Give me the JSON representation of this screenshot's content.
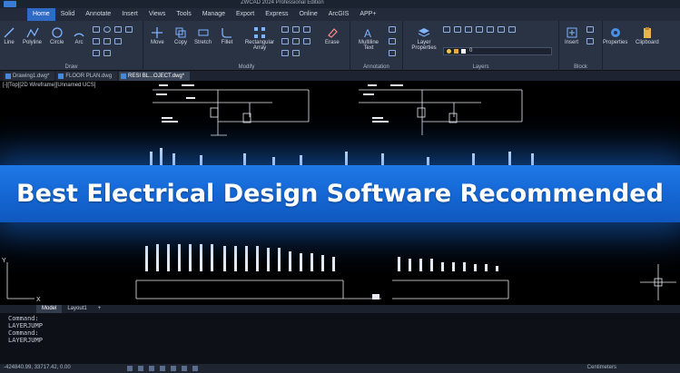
{
  "window": {
    "title": "ZWCAD 2024 Professional Edition"
  },
  "ribbon_tabs": [
    "Home",
    "Solid",
    "Annotate",
    "Insert",
    "Views",
    "Tools",
    "Manage",
    "Export",
    "Express",
    "Online",
    "ArcGIS",
    "APP+"
  ],
  "ribbon": {
    "draw": {
      "label": "Draw",
      "tools": [
        "Line",
        "Polyline",
        "Circle",
        "Arc"
      ]
    },
    "modify": {
      "label": "Modify",
      "tools": [
        "Move",
        "Copy",
        "Stretch",
        "Fillet",
        "Rectangular Array",
        "Erase"
      ]
    },
    "annotation": {
      "label": "Annotation",
      "tools": [
        "Multiline Text"
      ]
    },
    "layers": {
      "label": "Layers",
      "tools": [
        "Layer Properties"
      ],
      "current_layer": "0"
    },
    "block": {
      "label": "Block",
      "tools": [
        "Insert"
      ]
    },
    "extra": [
      "Properties",
      "Clipboard"
    ]
  },
  "doc_tabs": [
    "Drawing1.dwg*",
    "FLOOR PLAN.dwg",
    "RESI BL...OJECT.dwg*"
  ],
  "viewport": {
    "label": "[-][Top][2D Wireframe][Unnamed UCS]"
  },
  "banner": {
    "text": "Best Electrical Design Software Recommended"
  },
  "ucs": {
    "x": "X",
    "y": "Y"
  },
  "layout_tabs": [
    "Model",
    "Layout1",
    "+"
  ],
  "command_lines": [
    "Command:",
    "LAYERJUMP",
    "Command:",
    "LAYERJUMP"
  ],
  "status": {
    "coords": "-424840.99, 33717.42, 0.00",
    "right": "Centimeters"
  },
  "colors": {
    "accent": "#2f6bc4",
    "banner": "#1567d4",
    "canvas": "#000000",
    "ribbon": "#2a3344"
  }
}
